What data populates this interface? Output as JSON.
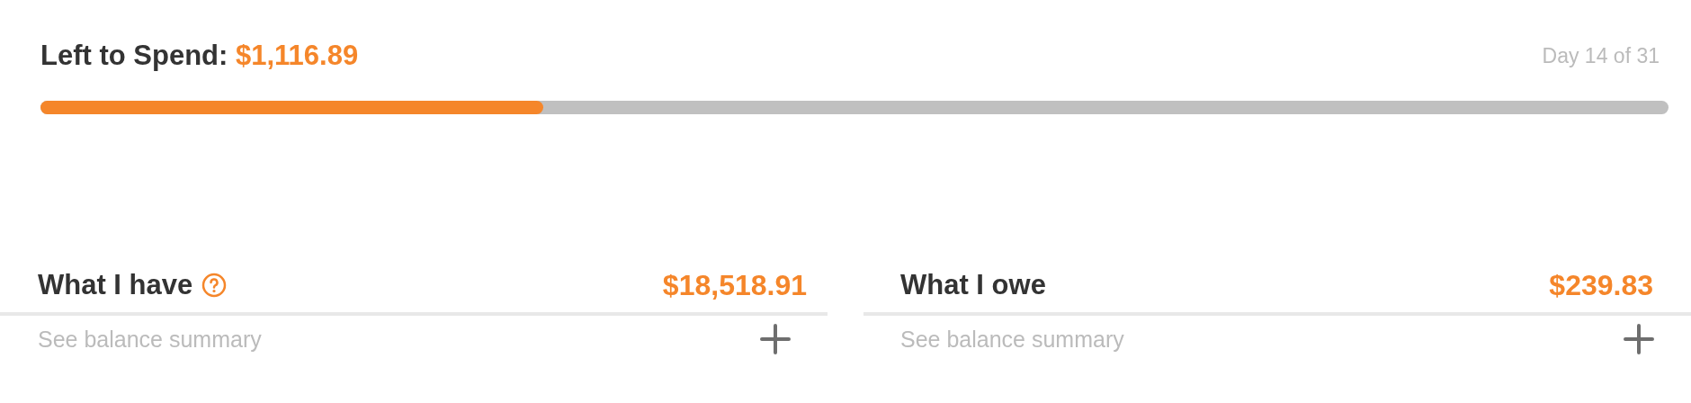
{
  "budget": {
    "label": "Left to Spend:",
    "amount": "$1,116.89",
    "day": "Day 14 of 31",
    "level": 0.309
  },
  "cards": [
    {
      "title": "What I have",
      "help": true,
      "amount": "$18,518.91",
      "link": "See balance summary"
    },
    {
      "title": "What I owe",
      "help": false,
      "amount": "$239.83",
      "link": "See balance summary"
    }
  ]
}
